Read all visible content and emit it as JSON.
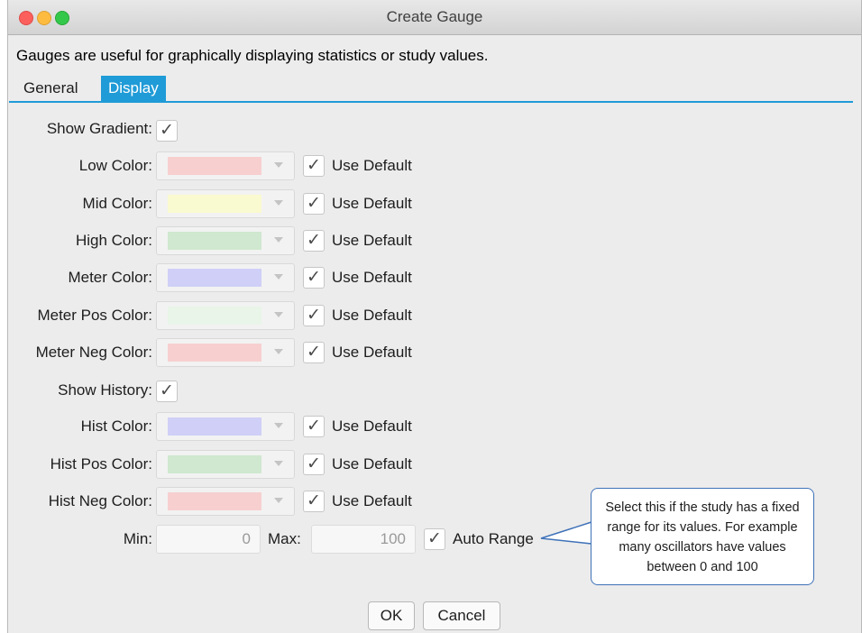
{
  "window": {
    "title": "Create Gauge"
  },
  "description": "Gauges are useful for graphically displaying statistics or study values.",
  "tabs": [
    {
      "label": "General",
      "active": false
    },
    {
      "label": "Display",
      "active": true
    }
  ],
  "accent_color": "#1f9bd7",
  "show_gradient": {
    "label": "Show Gradient:",
    "checked": true
  },
  "colors": [
    {
      "label": "Low Color:",
      "swatch": "#f7cfcf",
      "use_default": "Use Default",
      "checked": true
    },
    {
      "label": "Mid Color:",
      "swatch": "#fafad0",
      "use_default": "Use Default",
      "checked": true
    },
    {
      "label": "High Color:",
      "swatch": "#cfe8cf",
      "use_default": "Use Default",
      "checked": true
    },
    {
      "label": "Meter Color:",
      "swatch": "#cfcff7",
      "use_default": "Use Default",
      "checked": true
    },
    {
      "label": "Meter Pos Color:",
      "swatch": "#e8f5e8",
      "use_default": "Use Default",
      "checked": true
    },
    {
      "label": "Meter Neg Color:",
      "swatch": "#f7cfcf",
      "use_default": "Use Default",
      "checked": true
    }
  ],
  "show_history": {
    "label": "Show History:",
    "checked": true
  },
  "hist_colors": [
    {
      "label": "Hist Color:",
      "swatch": "#cfcff7",
      "use_default": "Use Default",
      "checked": true
    },
    {
      "label": "Hist Pos Color:",
      "swatch": "#cfe8cf",
      "use_default": "Use Default",
      "checked": true
    },
    {
      "label": "Hist Neg Color:",
      "swatch": "#f7cfcf",
      "use_default": "Use Default",
      "checked": true
    }
  ],
  "range": {
    "min_label": "Min:",
    "min_value": "0",
    "max_label": "Max:",
    "max_value": "100",
    "auto_range_label": "Auto Range",
    "auto_range_checked": true
  },
  "callout": "Select this if the study has a fixed range for its values.  For example many oscillators have values between 0 and 100",
  "buttons": {
    "ok": "OK",
    "cancel": "Cancel"
  }
}
